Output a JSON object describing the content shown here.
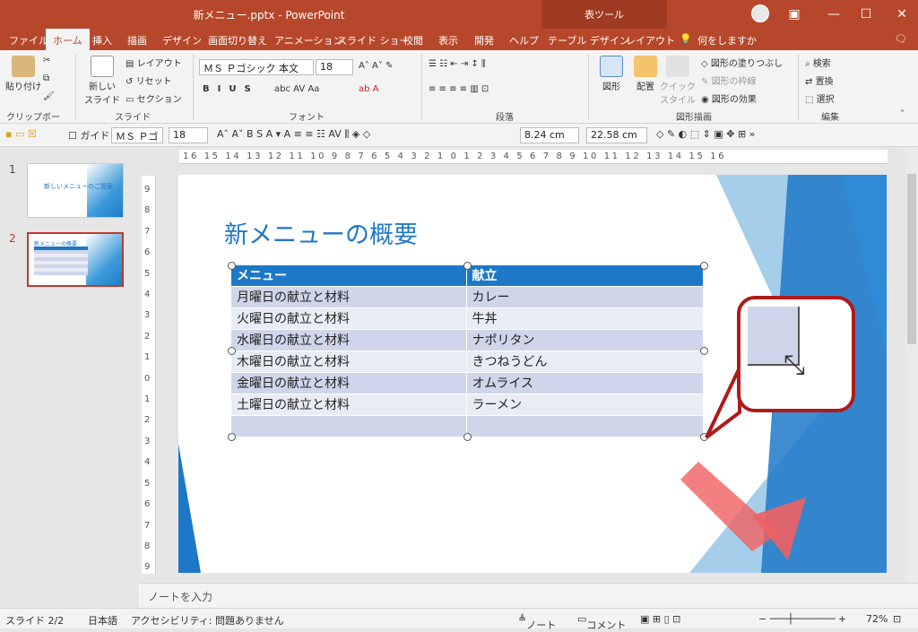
{
  "titlebar": {
    "title": "新メニュー.pptx  -  PowerPoint",
    "context": "表ツール"
  },
  "tabs": [
    "ファイル",
    "ホーム",
    "挿入",
    "描画",
    "デザイン",
    "画面切り替え",
    "アニメーション",
    "スライド ショー",
    "校閲",
    "表示",
    "開発",
    "ヘルプ",
    "テーブル デザイン",
    "レイアウト",
    "何をしますか"
  ],
  "ribbon": {
    "clipboard": {
      "paste": "貼り付け",
      "label": "クリップボード"
    },
    "slides": {
      "new": "新しい\nスライド",
      "layout": "レイアウト",
      "reset": "リセット",
      "section": "セクション",
      "label": "スライド"
    },
    "font": {
      "name": "ＭＳ Ｐゴシック 本文",
      "size": "18",
      "label": "フォント"
    },
    "paragraph": {
      "label": "段落"
    },
    "drawing": {
      "shape": "図形",
      "arrange": "配置",
      "quick": "クイック\nスタイル",
      "fill": "図形の塗りつぶし",
      "line": "図形の枠線",
      "effect": "図形の効果",
      "label": "図形描画"
    },
    "editing": {
      "find": "検索",
      "replace": "置換",
      "select": "選択",
      "label": "編集"
    }
  },
  "qat": {
    "guide": "ガイド",
    "font": "ＭＳ Ｐゴ",
    "size": "18",
    "height": "8.24 cm",
    "width": "22.58 cm"
  },
  "thumbs": [
    {
      "num": "1",
      "title": "新しいメニューのご提案"
    },
    {
      "num": "2",
      "title": "新メニューの概要"
    }
  ],
  "hruler": "16 15 14 13 12 11 10 9 8 7 6 5 4 3 2 1 0 1 2 3 4 5 6 7 8 9 10 11 12 13 14 15 16",
  "vruler": "9 8 7 6 5 4 3 2 1 0 1 2 3 4 5 6 7 8 9",
  "slide": {
    "title": "新メニューの概要",
    "table": {
      "headers": [
        "メニュー",
        "献立"
      ],
      "rows": [
        [
          "月曜日の献立と材料",
          "カレー"
        ],
        [
          "火曜日の献立と材料",
          "牛丼"
        ],
        [
          "水曜日の献立と材料",
          "ナポリタン"
        ],
        [
          "木曜日の献立と材料",
          "きつねうどん"
        ],
        [
          "金曜日の献立と材料",
          "オムライス"
        ],
        [
          "土曜日の献立と材料",
          "ラーメン"
        ],
        [
          "",
          ""
        ]
      ]
    }
  },
  "notes": "ノートを入力",
  "status": {
    "slide": "スライド 2/2",
    "lang": "日本語",
    "access": "アクセシビリティ: 問題ありません",
    "note": "ノート",
    "comment": "コメント",
    "zoom": "72%"
  },
  "colors": {
    "brand": "#b7472a",
    "accent": "#1e78c8",
    "callout": "#b01a1a"
  }
}
